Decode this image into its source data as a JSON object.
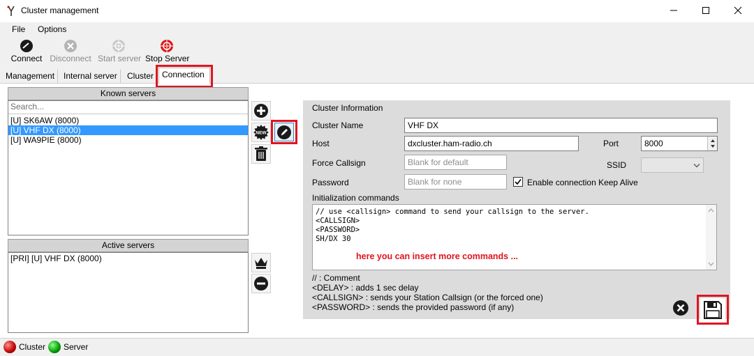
{
  "window": {
    "title": "Cluster management",
    "minimize_glyph": "—",
    "maximize_glyph": "☐",
    "close_glyph": "✕"
  },
  "menu": {
    "file": "File",
    "options": "Options"
  },
  "toolbar": {
    "connect": "Connect",
    "disconnect": "Disconnect",
    "start_server": "Start server",
    "stop_server": "Stop Server"
  },
  "tabs": [
    {
      "label": "Management"
    },
    {
      "label": "Internal server"
    },
    {
      "label": "Cluster"
    },
    {
      "label": "Connection"
    }
  ],
  "known_servers": {
    "header": "Known servers",
    "search_placeholder": "Search...",
    "items": [
      {
        "label": "[U] SK6AW (8000)"
      },
      {
        "label": "[U] VHF DX (8000)"
      },
      {
        "label": "[U] WA9PIE (8000)"
      }
    ],
    "new_badge": "NEW"
  },
  "active_servers": {
    "header": "Active servers",
    "items": [
      {
        "label": "[PRI] [U] VHF DX (8000)"
      }
    ]
  },
  "cluster_info": {
    "section_title": "Cluster Information",
    "cluster_name_label": "Cluster Name",
    "cluster_name_value": "VHF DX",
    "host_label": "Host",
    "host_value": "dxcluster.ham-radio.ch",
    "port_label": "Port",
    "port_value": "8000",
    "force_callsign_label": "Force Callsign",
    "force_callsign_placeholder": "Blank for default",
    "ssid_label": "SSID",
    "password_label": "Password",
    "password_placeholder": "Blank for none",
    "keepalive_label": "Enable connection Keep Alive",
    "keepalive_checked": true,
    "init_commands_label": "Initialization commands",
    "init_lines": [
      "// use <callsign> command to send your callsign to the server.",
      "<CALLSIGN>",
      "<PASSWORD>",
      "SH/DX 30"
    ],
    "annotation": "here you can insert more commands ...",
    "help_lines": [
      "// : Comment",
      "<DELAY> : adds 1 sec delay",
      "<CALLSIGN> : sends your Station Callsign (or the forced one)",
      "<PASSWORD> : sends the provided password (if any)"
    ]
  },
  "status": {
    "cluster": "Cluster",
    "server": "Server"
  },
  "colors": {
    "highlight": "#e0141e",
    "selection": "#3399ff",
    "annotation": "#e0141e",
    "panel": "#dcdcdc"
  }
}
